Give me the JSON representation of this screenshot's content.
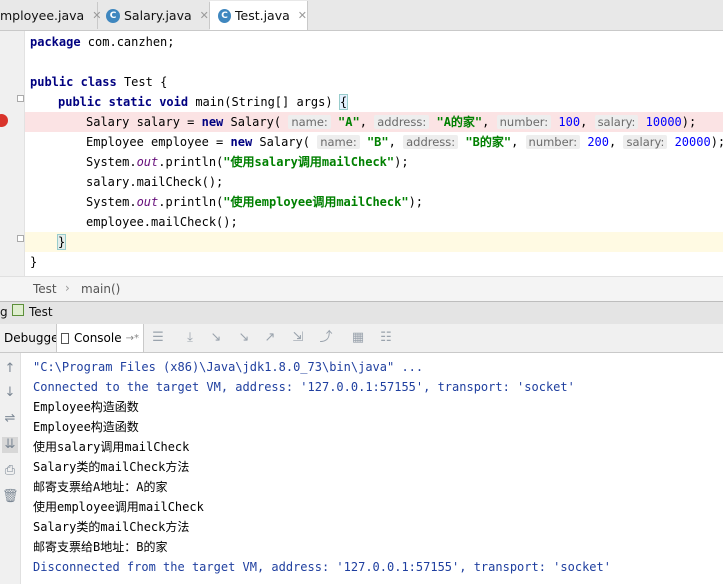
{
  "tabs": [
    {
      "label": "mployee.java",
      "active": false
    },
    {
      "label": "Salary.java",
      "active": false
    },
    {
      "label": "Test.java",
      "active": true
    }
  ],
  "code": {
    "l1_kw": "package",
    "l1_rest": " com.canzhen;",
    "l3_kw1": "public",
    "l3_kw2": "class",
    "l3_rest": " Test {",
    "l4_kw1": "public",
    "l4_kw2": "static",
    "l4_kw3": "void",
    "l4_rest": " main(String[] args) ",
    "l4_brace": "{",
    "l5_a": "Salary salary = ",
    "l5_new": "new",
    "l5_b": " Salary(",
    "l5_h1": "name:",
    "l5_s1": "\"A\"",
    "l5_h2": "address:",
    "l5_s2": "\"A的家\"",
    "l5_h3": "number:",
    "l5_n1": "100",
    "l5_h4": "salary:",
    "l5_n2": "10000",
    "l5_end": ");",
    "l6_a": "Employee employee = ",
    "l6_new": "new",
    "l6_b": " Salary(",
    "l6_h1": "name:",
    "l6_s1": "\"B\"",
    "l6_h2": "address:",
    "l6_s2": "\"B的家\"",
    "l6_h3": "number:",
    "l6_n1": "200",
    "l6_h4": "salary:",
    "l6_n2": "20000",
    "l6_end": ");",
    "l7_a": "System.",
    "l7_out": "out",
    "l7_b": ".println(",
    "l7_s": "\"使用salary调用mailCheck\"",
    "l7_end": ");",
    "l8": "salary.mailCheck();",
    "l9_a": "System.",
    "l9_out": "out",
    "l9_b": ".println(",
    "l9_s": "\"使用employee调用mailCheck\"",
    "l9_end": ");",
    "l10": "employee.mailCheck();",
    "l11": "}",
    "l12": "}"
  },
  "breadcrumb": {
    "item1": "Test",
    "sep": "›",
    "item2": "main()"
  },
  "run_header": {
    "prefix": "g",
    "title": "Test"
  },
  "debug_tabs": {
    "debugger": "Debugger",
    "console": "Console",
    "console_arrow": "→*"
  },
  "console_lines": [
    {
      "text": "\"C:\\Program Files (x86)\\Java\\jdk1.8.0_73\\bin\\java\" ...",
      "kind": "sys"
    },
    {
      "text": "Connected to the target VM, address: '127.0.0.1:57155', transport: 'socket'",
      "kind": "sys"
    },
    {
      "text": "Employee构造函数",
      "kind": "out"
    },
    {
      "text": "Employee构造函数",
      "kind": "out"
    },
    {
      "text": "使用salary调用mailCheck",
      "kind": "out"
    },
    {
      "text": "Salary类的mailCheck方法",
      "kind": "out"
    },
    {
      "text": "邮寄支票给A地址：A的家",
      "kind": "out"
    },
    {
      "text": "使用employee调用mailCheck",
      "kind": "out"
    },
    {
      "text": "Salary类的mailCheck方法",
      "kind": "out"
    },
    {
      "text": "邮寄支票给B地址：B的家",
      "kind": "out"
    },
    {
      "text": "Disconnected from the target VM, address: '127.0.0.1:57155', transport: 'socket'",
      "kind": "sys"
    }
  ],
  "colors": {
    "keyword": "#000080",
    "string": "#008000",
    "number": "#0000ff",
    "breakpoint": "#d9342b",
    "console_sys": "#1f3f9f"
  }
}
